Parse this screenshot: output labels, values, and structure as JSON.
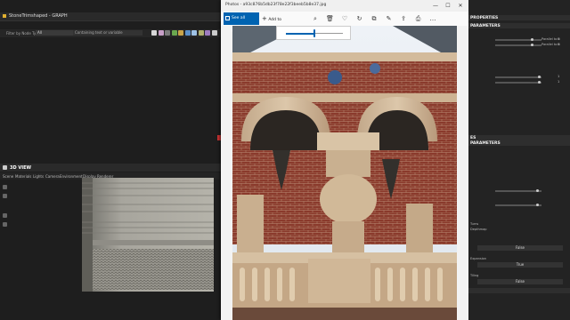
{
  "graph": {
    "tab_title": "StoneTrimshaped - GRAPH",
    "filter_label": "Filter by Node Type:",
    "filter_value": "All",
    "filter_input_placeholder": "Containing text or variable",
    "filter_buttons_colors": [
      "#d8d8d8",
      "#c8a0c8",
      "#7a7a7a",
      "#6aa84f",
      "#c9a44a",
      "#5b8fc9",
      "#9ec2e6",
      "#b0b070",
      "#9d7bbf",
      "#cccccc"
    ]
  },
  "view3d": {
    "title": "3D VIEW",
    "menu": [
      "Scene",
      "Materials",
      "Lights",
      "Camera",
      "Environment",
      "Display",
      "Renderer"
    ]
  },
  "photos": {
    "window_title": "Photos - a93c876b5db23f78e22f3beeb5b8e37.jpg",
    "window_controls": [
      "—",
      "☐",
      "✕"
    ],
    "see_all": "See all photos",
    "add_to": "Add to",
    "toolbar_icons": [
      "zoom-icon",
      "delete-icon",
      "favorite-icon",
      "rotate-icon",
      "crop-icon",
      "edit-icon",
      "share-icon",
      "print-icon",
      "more-icon"
    ],
    "toolbar_glyphs": [
      "⌕",
      "🗑",
      "♡",
      "↻",
      "⧉",
      "✎",
      "⇪",
      "⎙",
      "…"
    ],
    "zoom_level": 0.5
  },
  "props": {
    "sections": [
      "PROPERTIES",
      "PARAMETERS",
      "PARAMETERS",
      "ES"
    ],
    "small_labels": [
      "Parallel to it",
      "Parallel to it"
    ],
    "values": [
      "0",
      "0",
      "1",
      "1"
    ],
    "labels_bottom": [
      "Turns",
      "Depthmap",
      "Expansion",
      "Tiling"
    ],
    "button_values": [
      "False",
      "True",
      "False"
    ]
  },
  "accent": "#0063b1"
}
